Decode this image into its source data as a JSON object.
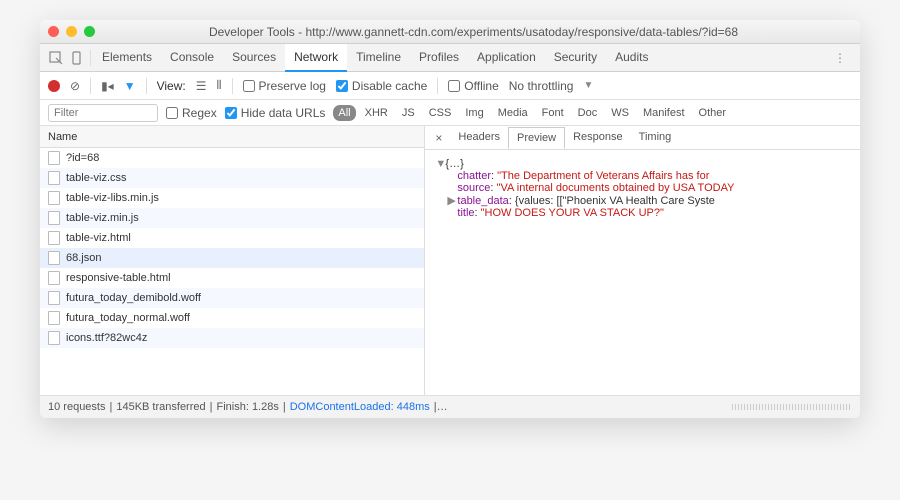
{
  "title": "Developer Tools - http://www.gannett-cdn.com/experiments/usatoday/responsive/data-tables/?id=68",
  "tabs": [
    "Elements",
    "Console",
    "Sources",
    "Network",
    "Timeline",
    "Profiles",
    "Application",
    "Security",
    "Audits"
  ],
  "active_tab": "Network",
  "toolbar": {
    "view_label": "View:",
    "preserve_log": "Preserve log",
    "disable_cache": "Disable cache",
    "offline": "Offline",
    "throttling": "No throttling"
  },
  "filter": {
    "placeholder": "Filter",
    "regex": "Regex",
    "hide_urls": "Hide data URLs",
    "types": [
      "All",
      "XHR",
      "JS",
      "CSS",
      "Img",
      "Media",
      "Font",
      "Doc",
      "WS",
      "Manifest",
      "Other"
    ],
    "active_type": "All"
  },
  "list": {
    "header": "Name",
    "rows": [
      "?id=68",
      "table-viz.css",
      "table-viz-libs.min.js",
      "table-viz.min.js",
      "table-viz.html",
      "68.json",
      "responsive-table.html",
      "futura_today_demibold.woff",
      "futura_today_normal.woff",
      "icons.ttf?82wc4z"
    ],
    "selected": "68.json"
  },
  "detail": {
    "tabs": [
      "Headers",
      "Preview",
      "Response",
      "Timing"
    ],
    "active": "Preview",
    "preview": {
      "root": "{…}",
      "chatter_key": "chatter",
      "chatter_val": "\"The Department of Veterans Affairs has for",
      "source_key": "source",
      "source_val": "\"VA internal documents obtained by USA TODAY",
      "table_key": "table_data",
      "table_val": "{values: [[\"Phoenix VA Health Care Syste",
      "title_key": "title",
      "title_val": "\"HOW DOES YOUR VA STACK UP?\""
    }
  },
  "status": {
    "requests": "10 requests",
    "transferred": "145KB transferred",
    "finish": "Finish: 1.28s",
    "dcl": "DOMContentLoaded: 448ms",
    "more": "|…"
  }
}
